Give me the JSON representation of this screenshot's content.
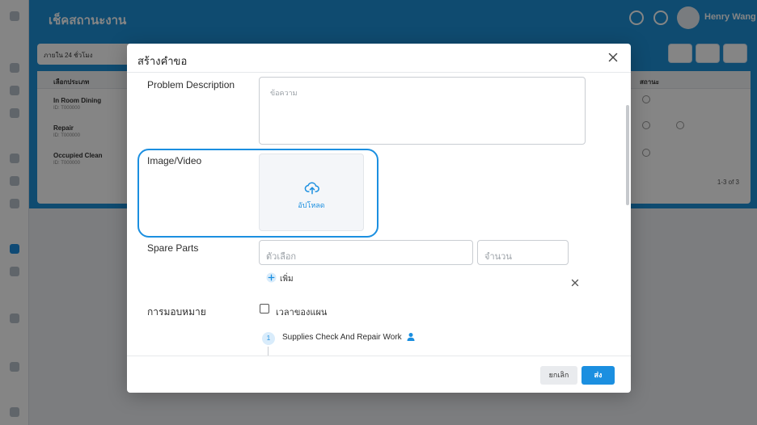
{
  "background": {
    "page_title": "เช็คสถานะงาน",
    "user_name": "Henry Wang",
    "filter_placeholder": "ภายใน 24 ชั่วโมง",
    "columns": [
      "เลือกประเภท",
      "สถานะ"
    ],
    "rows": [
      {
        "name": "In Room Dining",
        "sub": "ID: T000000"
      },
      {
        "name": "Repair",
        "sub": "ID: T000000"
      },
      {
        "name": "Occupied Clean",
        "sub": "ID: T000000"
      }
    ],
    "pagination": "1-3 of 3"
  },
  "modal": {
    "title": "สร้างคำขอ",
    "problem_label": "Problem Description",
    "problem_placeholder": "ข้อความ",
    "image_label": "Image/Video",
    "upload_label": "อัปโหลด",
    "spare_parts_label": "Spare Parts",
    "option_placeholder": "ตัวเลือก",
    "quantity_placeholder": "จำนวน",
    "add_label": "เพิ่ม",
    "assign_label": "การมอบหมาย",
    "plan_time_label": "เวลาของแผน",
    "step_number": "1",
    "step_text": "Supplies Check And Repair Work",
    "cancel_label": "ยกเลิก",
    "submit_label": "ส่ง"
  },
  "colors": {
    "accent": "#1b8fe0",
    "header_blue": "#1e90d6",
    "overlay": "rgba(0,0,0,0.48)"
  }
}
